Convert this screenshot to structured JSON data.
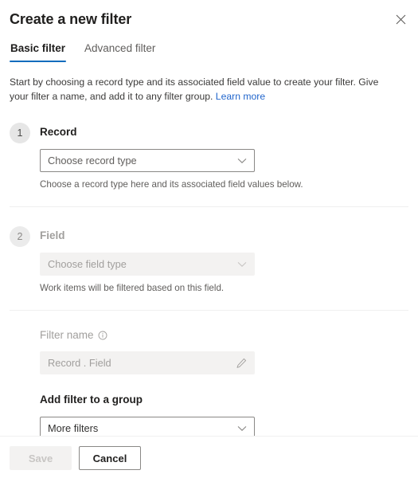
{
  "dialog": {
    "title": "Create a new filter",
    "close_label": "Close"
  },
  "tabs": [
    {
      "label": "Basic filter",
      "active": true
    },
    {
      "label": "Advanced filter",
      "active": false
    }
  ],
  "intro": {
    "text": "Start by choosing a record type and its associated field value to create your filter. Give your filter a name, and add it to any filter group.",
    "link_label": "Learn more"
  },
  "steps": [
    {
      "number": "1",
      "label": "Record",
      "dropdown_value": "Choose record type",
      "help_text": "Choose a record type here and its associated field values below.",
      "disabled": false
    },
    {
      "number": "2",
      "label": "Field",
      "dropdown_value": "Choose field type",
      "help_text": "Work items will be filtered based on this field.",
      "disabled": true
    }
  ],
  "filter_name": {
    "label": "Filter name",
    "placeholder": "Record . Field",
    "value": ""
  },
  "group": {
    "label": "Add filter to a group",
    "dropdown_value": "More filters"
  },
  "footer": {
    "save_label": "Save",
    "cancel_label": "Cancel"
  },
  "colors": {
    "accent": "#0f6cbd",
    "link": "#2266cc",
    "border": "#8a8886",
    "disabled_bg": "#f3f2f1",
    "step_circle": "#e6e6e6"
  }
}
